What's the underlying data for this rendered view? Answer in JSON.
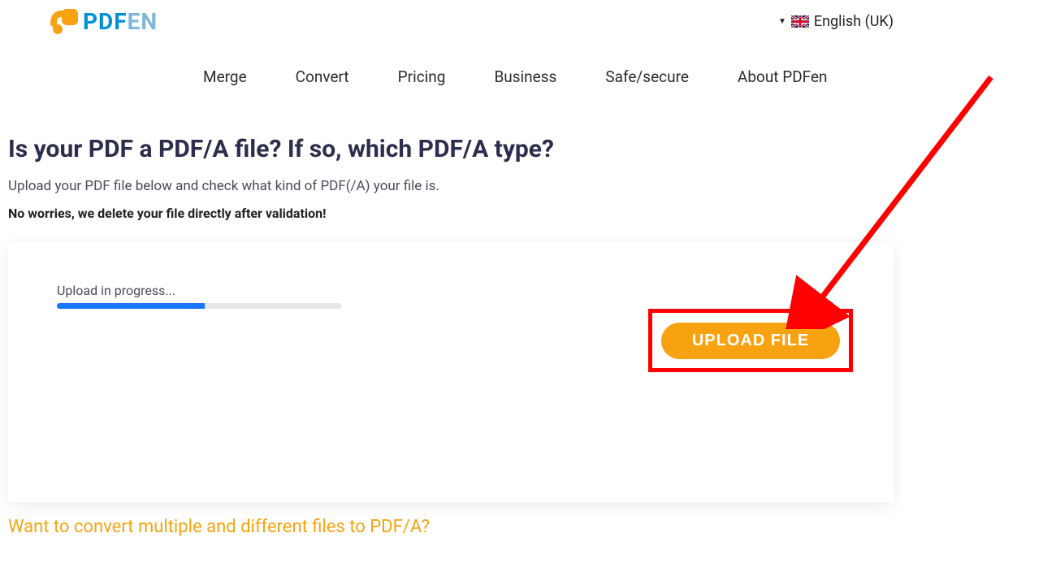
{
  "header": {
    "logo": {
      "pdf": "PDF",
      "en": "EN"
    },
    "language": {
      "label": "English (UK)"
    }
  },
  "nav": {
    "items": [
      {
        "label": "Merge"
      },
      {
        "label": "Convert"
      },
      {
        "label": "Pricing"
      },
      {
        "label": "Business"
      },
      {
        "label": "Safe/secure"
      },
      {
        "label": "About PDFen"
      }
    ]
  },
  "main": {
    "heading": "Is your PDF a PDF/A file? If so, which PDF/A type?",
    "subtext": "Upload your PDF file below and check what kind of PDF(/A) your file is.",
    "boldtext": "No worries, we delete your file directly after validation!",
    "upload": {
      "progress_label": "Upload in progress...",
      "progress_percent": 52,
      "button_label": "UPLOAD FILE"
    },
    "bottom_link": "Want to convert multiple and different files to PDF/A?"
  },
  "colors": {
    "accent_blue": "#0091d4",
    "accent_orange": "#f7a311",
    "highlight_red": "#ff0000",
    "progress_blue": "#1976ff"
  }
}
